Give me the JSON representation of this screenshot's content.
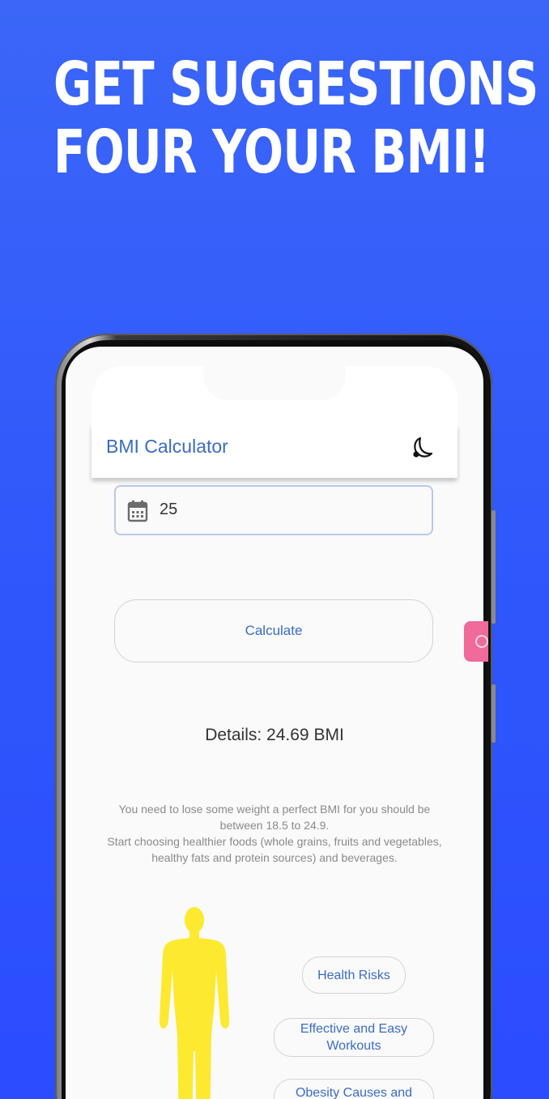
{
  "headline": {
    "line1": "GET SUGGESTIONS",
    "line2": "FOUR YOUR BMI!"
  },
  "app": {
    "title": "BMI Calculator",
    "theme_toggle_icon": "moon-icon"
  },
  "age_field": {
    "icon": "calendar-icon",
    "value": "25"
  },
  "calculate_label": "Calculate",
  "details_text": "Details: 24.69 BMI",
  "advice": {
    "line1": "You need to lose some weight a perfect BMI for you should be between 18.5 to 24.9.",
    "line2": "Start choosing healthier foods (whole grains, fruits and vegetables, healthy fats and protein sources) and beverages."
  },
  "chips": [
    {
      "label": "Health Risks"
    },
    {
      "label": "Effective and Easy Workouts"
    },
    {
      "label": "Obesity Causes and"
    }
  ],
  "colors": {
    "background": "#2f56fb",
    "accent": "#3a6cc4",
    "body_figure": "#fde92f",
    "side_tab": "#f06a9a"
  }
}
